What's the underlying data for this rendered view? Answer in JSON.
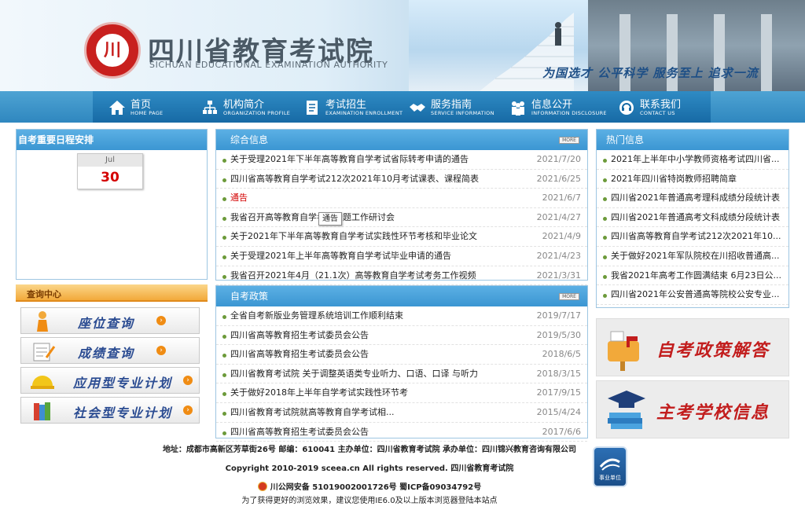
{
  "header": {
    "logo_text": "川",
    "title": "四川省教育考试院",
    "subtitle": "SICHUAN EDUCATIONAL EXAMINATION AUTHORITY",
    "slogan": "为国选才  公平科学  服务至上  追求一流"
  },
  "nav": {
    "items": [
      {
        "zh": "首页",
        "en": "HOME PAGE",
        "icon": "home-icon"
      },
      {
        "zh": "机构简介",
        "en": "ORGANIZATION PROFILE",
        "icon": "org-chart-icon"
      },
      {
        "zh": "考试招生",
        "en": "EXAMINATION ENROLLMENT",
        "icon": "document-icon"
      },
      {
        "zh": "服务指南",
        "en": "SERVICE INFORMATION",
        "icon": "handshake-icon"
      },
      {
        "zh": "信息公开",
        "en": "INFORMATION DISCLOSURE",
        "icon": "people-icon"
      },
      {
        "zh": "联系我们",
        "en": "CONTACT US",
        "icon": "contact-icon"
      }
    ]
  },
  "schedule": {
    "title": "自考重要日程安排",
    "month": "Jul",
    "day": "30"
  },
  "query": {
    "title": "查询中心",
    "buttons": [
      {
        "label": "座位查询",
        "icon": "person-icon"
      },
      {
        "label": "成绩查询",
        "icon": "grade-icon"
      },
      {
        "label": "应用型专业计划",
        "icon": "helmet-icon"
      },
      {
        "label": "社会型专业计划",
        "icon": "books-icon"
      }
    ]
  },
  "general_info": {
    "title": "综合信息",
    "more": "MORE",
    "items": [
      {
        "title": "关于受理2021年下半年高等教育自学考试省际转考申请的通告",
        "date": "2021/7/20",
        "red": false
      },
      {
        "title": "四川省高等教育自学考试212次2021年10月考试课表、课程简表",
        "date": "2021/6/25",
        "red": false
      },
      {
        "title": "通告",
        "date": "2021/6/7",
        "red": true
      },
      {
        "title": "我省召开高等教育自学考试命题工作研讨会",
        "date": "2021/4/27",
        "red": false
      },
      {
        "title": "关于2021年下半年高等教育自学考试实践性环节考核和毕业论文",
        "date": "2021/4/9",
        "red": false
      },
      {
        "title": "关于受理2021年上半年高等教育自学考试毕业申请的通告",
        "date": "2021/4/23",
        "red": false
      },
      {
        "title": "我省召开2021年4月（21.1次）高等教育自学考试考务工作视频",
        "date": "2021/3/31",
        "red": false
      }
    ]
  },
  "policy": {
    "title": "自考政策",
    "more": "MORE",
    "items": [
      {
        "title": "全省自考新版业务管理系统培训工作顺利结束",
        "date": "2019/7/17"
      },
      {
        "title": "四川省高等教育招生考试委员会公告",
        "date": "2019/5/30"
      },
      {
        "title": "四川省高等教育招生考试委员会公告",
        "date": "2018/6/5"
      },
      {
        "title": "四川省教育考试院 关于调整英语类专业听力、口语、口译 与听力",
        "date": "2018/3/15"
      },
      {
        "title": "关于做好2018年上半年自学考试实践性环节考",
        "date": "2017/9/15"
      },
      {
        "title": "四川省教育考试院就高等教育自学考试相...",
        "date": "2015/4/24"
      },
      {
        "title": "四川省高等教育招生考试委员会公告",
        "date": "2017/6/6"
      }
    ]
  },
  "hot": {
    "title": "热门信息",
    "items": [
      "2021年上半年中小学教师资格考试四川省...",
      "2021年四川省特岗教师招聘简章",
      "四川省2021年普通高考理科成绩分段统计表",
      "四川省2021年普通高考文科成绩分段统计表",
      "四川省高等教育自学考试212次2021年10...",
      "关于做好2021年军队院校在川招收普通高...",
      "我省2021年高考工作圆满结束 6月23日公...",
      "四川省2021年公安普通高等院校公安专业..."
    ]
  },
  "banners": [
    {
      "label": "自考政策解答",
      "icon": "mailbox-icon"
    },
    {
      "label": "主考学校信息",
      "icon": "graduation-cap-icon"
    }
  ],
  "tooltip": "通告",
  "footer": {
    "address": "地址：成都市高新区芳草街26号  邮编：610041  主办单位：四川省教育考试院  承办单位：四川锦兴教育咨询有限公司",
    "copyright": "Copyright 2010-2019 sceea.cn All rights reserved. 四川省教育考试院",
    "beian": "川公网安备 51019002001726号    蜀ICP备09034792号",
    "browser_tip": "为了获得更好的浏览效果，建议您使用IE6.0及以上版本浏览器登陆本站点",
    "badge": "事业单位"
  },
  "colors": {
    "nav_blue": "#176aa5",
    "panel_head": "#3b96d2",
    "red_text": "#d40000",
    "query_orange": "#f2a93a",
    "banner_red": "#c21d1d",
    "query_label_blue": "#2b4c92"
  }
}
